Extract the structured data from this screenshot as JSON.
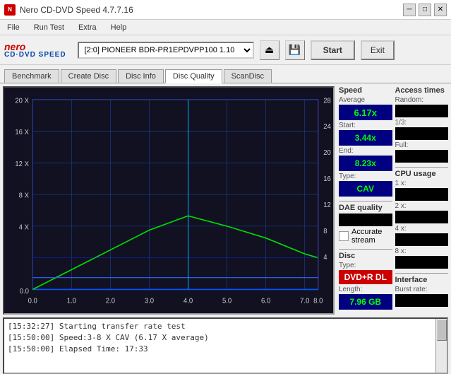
{
  "app": {
    "title": "Nero CD-DVD Speed 4.7.7.16",
    "icon": "N"
  },
  "menu": {
    "items": [
      "File",
      "Run Test",
      "Extra",
      "Help"
    ]
  },
  "toolbar": {
    "logo_top": "nero",
    "logo_bottom": "CD·DVD SPEED",
    "drive": "[2:0]  PIONEER BDR-PR1EPDVPP100 1.10",
    "start_label": "Start",
    "exit_label": "Exit"
  },
  "tabs": {
    "items": [
      "Benchmark",
      "Create Disc",
      "Disc Info",
      "Disc Quality",
      "ScanDisc"
    ],
    "active": "Disc Quality"
  },
  "chart": {
    "y_left_labels": [
      "20 X",
      "16 X",
      "12 X",
      "8 X",
      "4 X",
      "0.0"
    ],
    "y_right_labels": [
      "28",
      "24",
      "20",
      "16",
      "12",
      "8",
      "4"
    ],
    "x_labels": [
      "0.0",
      "1.0",
      "2.0",
      "3.0",
      "4.0",
      "5.0",
      "6.0",
      "7.0",
      "8.0"
    ],
    "title": "Disc Quality"
  },
  "stats": {
    "speed": {
      "header": "Speed",
      "average_label": "Average",
      "average_value": "6.17x",
      "start_label": "Start:",
      "start_value": "3.44x",
      "end_label": "End:",
      "end_value": "8.23x",
      "type_label": "Type:",
      "type_value": "CAV"
    },
    "access_times": {
      "header": "Access times",
      "random_label": "Random:",
      "random_value": "",
      "third_label": "1/3:",
      "third_value": "",
      "full_label": "Full:",
      "full_value": ""
    },
    "cpu": {
      "header": "CPU usage",
      "x1_label": "1 x:",
      "x1_value": "",
      "x2_label": "2 x:",
      "x2_value": "",
      "x4_label": "4 x:",
      "x4_value": "",
      "x8_label": "8 x:",
      "x8_value": ""
    },
    "dae": {
      "header": "DAE quality",
      "value": "",
      "accurate_label": "Accurate",
      "stream_label": "stream"
    },
    "disc": {
      "header": "Disc",
      "type_label": "Type:",
      "type_value": "DVD+R DL",
      "length_label": "Length:",
      "length_value": "7.96 GB"
    },
    "interface": {
      "header": "Interface",
      "burst_label": "Burst rate:",
      "burst_value": ""
    }
  },
  "log": {
    "lines": [
      "[15:32:27]  Starting transfer rate test",
      "[15:50:00]  Speed:3-8 X CAV (6.17 X average)",
      "[15:50:00]  Elapsed Time: 17:33"
    ]
  }
}
